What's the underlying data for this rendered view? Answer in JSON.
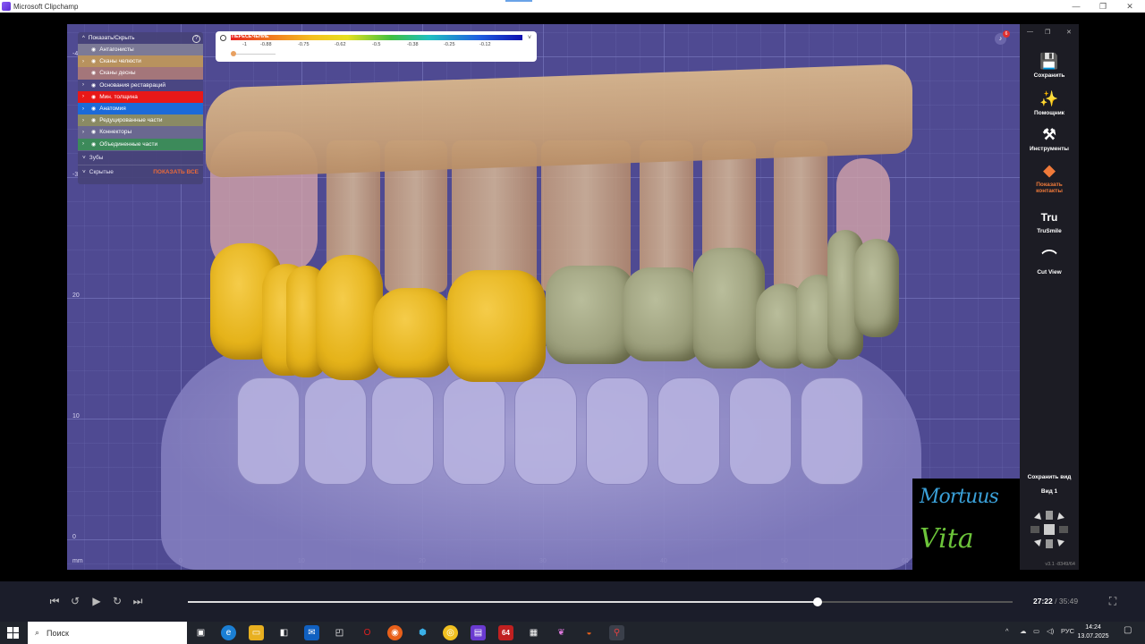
{
  "window": {
    "title": "Microsoft Clipchamp",
    "minimize": "—",
    "maximize": "❐",
    "close": "✕"
  },
  "viewport": {
    "axis_y": [
      "-4",
      "-3",
      "20",
      "10",
      "0"
    ],
    "axis_x": [
      "0",
      "10",
      "20",
      "30",
      "40",
      "50",
      "60"
    ],
    "axis_unit": "mm"
  },
  "layers_panel": {
    "header": "Показать/Скрыть",
    "help": "?",
    "items": [
      {
        "label": "Антагонисты",
        "color": "#7c7a96"
      },
      {
        "label": "Сканы челюсти",
        "color": "#b8925e"
      },
      {
        "label": "Сканы десны",
        "color": "#a4767a"
      },
      {
        "label": "Основания реставраций",
        "color": "#4a4682"
      },
      {
        "label": "Мин. толщина",
        "color": "#e81818"
      },
      {
        "label": "Анатомия",
        "color": "#1c6ad8"
      },
      {
        "label": "Редуцированные части",
        "color": "#8a8a64"
      },
      {
        "label": "Коннекторы",
        "color": "#6a6890"
      },
      {
        "label": "Объединенные части",
        "color": "#3c8a5a"
      }
    ],
    "teeth": "Зубы",
    "hidden": "Скрытые",
    "show_all": "ПОКАЗАТЬ ВСЕ"
  },
  "color_scale": {
    "label": "ПЕРЕСЕЧЕНИЕ",
    "ticks": [
      "-1",
      "-0.88",
      "-0.75",
      "-0.62",
      "-0.5",
      "-0.38",
      "-0.25",
      "-0.12"
    ]
  },
  "notifications": {
    "icon": "bell-icon",
    "count": "6"
  },
  "tools": {
    "save": "Сохранить",
    "assistant": "Помощник",
    "instruments": "Инструменты",
    "contacts": "Показать контакты",
    "trusmile": "TruSmile",
    "cutview": "Cut View",
    "save_view": "Сохранить вид",
    "view": "Вид 1",
    "version": "v3.1 -8349/64",
    "accent": "#f07a3a"
  },
  "logo": {
    "line1": "Mortuus",
    "line2": "Vita"
  },
  "player": {
    "current": "27:22",
    "separator": " / ",
    "duration": "35:49",
    "progress": 0.764
  },
  "taskbar": {
    "search_placeholder": "Поиск",
    "lang": "РУС",
    "time": "14:24",
    "date": "13.07.2025"
  }
}
